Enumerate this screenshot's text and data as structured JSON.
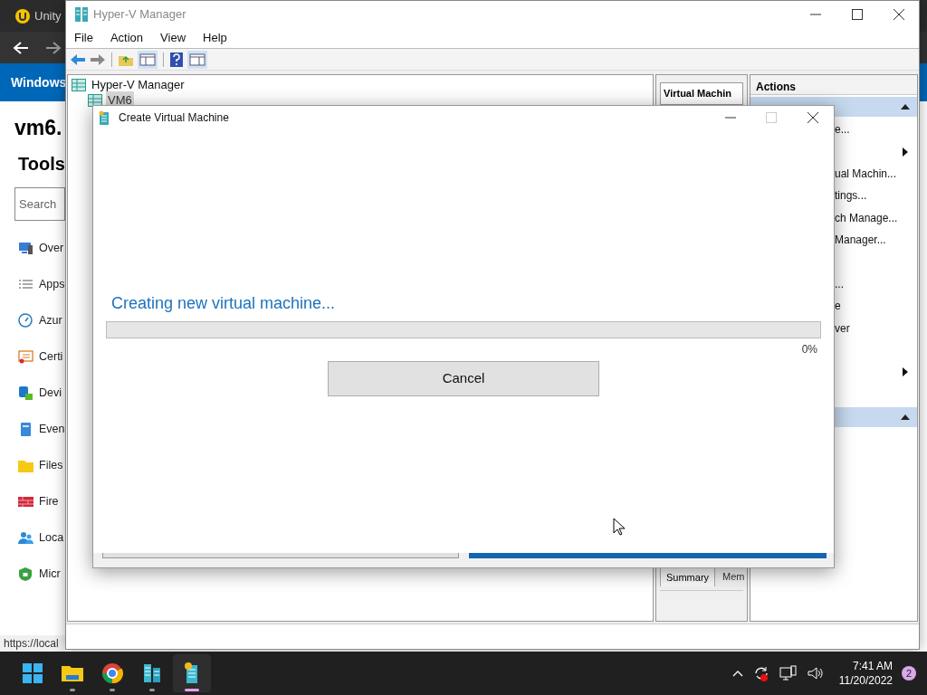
{
  "browser": {
    "tab_title": "Unity",
    "banner": "Windows",
    "heading": "vm6.",
    "section": "Tools",
    "search": {
      "placeholder": "Search"
    },
    "tools": [
      {
        "label": "Over",
        "kind": "monitor"
      },
      {
        "label": "Apps",
        "kind": "list"
      },
      {
        "label": "Azur",
        "kind": "gauge"
      },
      {
        "label": "Certi",
        "kind": "certificate"
      },
      {
        "label": "Devi",
        "kind": "devices"
      },
      {
        "label": "Even",
        "kind": "book"
      },
      {
        "label": "Files",
        "kind": "folder"
      },
      {
        "label": "Fire",
        "kind": "wall"
      },
      {
        "label": "Loca",
        "kind": "users"
      },
      {
        "label": "Micr",
        "kind": "shield"
      }
    ],
    "status_url": "https://local"
  },
  "hyperv": {
    "title": "Hyper-V Manager",
    "menu": [
      "File",
      "Action",
      "View",
      "Help"
    ],
    "tree": [
      {
        "label": "Hyper-V Manager",
        "selected": false,
        "children": [
          {
            "label": "VM6",
            "selected": true
          }
        ]
      }
    ],
    "center": {
      "header": "Virtual Machin",
      "tabs": [
        {
          "label": "Summary",
          "selected": true
        },
        {
          "label": "Mem",
          "selected": false
        }
      ]
    },
    "actions": {
      "title": "Actions",
      "items": [
        {
          "kind": "group"
        },
        {
          "kind": "item",
          "text": "e..."
        },
        {
          "kind": "submenu"
        },
        {
          "kind": "item",
          "text": "ual Machin..."
        },
        {
          "kind": "item",
          "text": "tings..."
        },
        {
          "kind": "item",
          "text": "ch Manage..."
        },
        {
          "kind": "item",
          "text": "Manager..."
        },
        {
          "kind": "blank"
        },
        {
          "kind": "item",
          "text": "..."
        },
        {
          "kind": "item",
          "text": "e"
        },
        {
          "kind": "item",
          "text": "ver"
        },
        {
          "kind": "blank"
        },
        {
          "kind": "submenu"
        },
        {
          "kind": "blank"
        },
        {
          "kind": "group"
        }
      ]
    }
  },
  "dialog": {
    "title": "Create Virtual Machine",
    "message": "Creating new virtual machine...",
    "progress": {
      "level": 0,
      "reading": "0%"
    },
    "button": "Cancel"
  },
  "taskbar": {
    "apps": [
      {
        "kind": "start",
        "selected": false
      },
      {
        "kind": "explorer",
        "selected": false
      },
      {
        "kind": "chrome",
        "selected": false
      },
      {
        "kind": "hyperv",
        "selected": false
      },
      {
        "kind": "wizard",
        "selected": true
      }
    ],
    "time": "7:41 AM",
    "date": "11/20/2022",
    "notifications": "2"
  }
}
